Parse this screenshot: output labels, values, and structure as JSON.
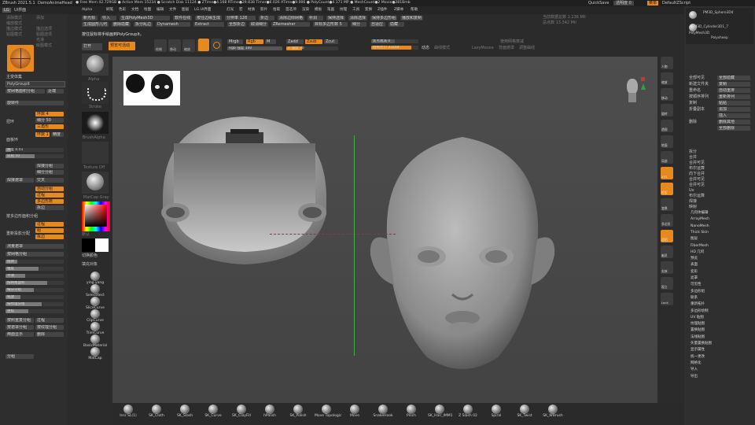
{
  "topbar": {
    "app_title": "ZBrush 2021.5.1",
    "doc_name": "DemoAnimeHead",
    "stats": "● Free Mem 42.729GB ● Active Mem 15234 ● Scratch Disk 11124 ● ZTime●4.168 RTime●29.838 Timer●6.026 ATime●9.006 ● PolyCount●4.171 MP ● MeshCount●2  Movie●281Bmb",
    "quicksave": "QuickSave",
    "see_through": "透明度 0",
    "menus_btn": "菜单",
    "script": "DefaultZScript"
  },
  "menubar": {
    "lightbox": "LG",
    "ui_label": "UI界面",
    "items": [
      "Alpha",
      "刷笔",
      "色彩",
      "文档",
      "绘图",
      "编辑",
      "文件",
      "图层",
      "LG.UI界面",
      "灯光",
      "宏",
      "材质",
      "影片",
      "拾取",
      "首选项",
      "渲染",
      "模板",
      "笔画",
      "纹理",
      "工具",
      "变换",
      "Z插件",
      "Z脚本",
      "帮助"
    ]
  },
  "left_panel": {
    "rows": [
      {
        "a": "清除模式",
        "b": "添加"
      },
      {
        "a": "缩放模式",
        "b": ""
      },
      {
        "a": "描边模式",
        "b": "描边选项"
      },
      {
        "a": "贴图模式",
        "b": "贴图选项"
      },
      {
        "a": "",
        "b": "光滑"
      },
      {
        "a": "",
        "b": "绘图模式"
      }
    ],
    "subtool_label": "主变体集",
    "polygroup_field": "PolyGroupIt",
    "polygroup_buttons": [
      "按网格面积分组",
      "近端"
    ],
    "rotate": "旋转件",
    "slices": [
      {
        "name": "扭环",
        "v1": "环数 4",
        "v2": "细分 50",
        "v3": "三角形",
        "v4": "环数 1",
        "v5": "精度"
      },
      {
        "name": "面板环"
      }
    ],
    "sliders": [
      {
        "label": "厚度 0.01",
        "fill": 0.1
      },
      {
        "label": "斜角 50",
        "fill": 0.5
      }
    ],
    "weld": [
      "焊接分组",
      "细分分组",
      "焊接遮罩",
      "交叉"
    ],
    "boolean": [
      "自动分组",
      "过程",
      "多边形数",
      "拆边"
    ],
    "more": [
      "按多边形面积分组",
      "过程",
      "组",
      "拆边",
      "重新投影分配",
      "按网格面积",
      "测量遮罩",
      "按网格分组"
    ],
    "bottom_sliders": [
      "扭转",
      "锥度",
      "平滑",
      "按网格面积",
      "细分分组",
      "缩放",
      "按纹理分组",
      "坐标"
    ],
    "footer": [
      "按照重复分组",
      "过程",
      "按遮罩分组",
      "按纹理分组",
      "两面显示",
      "删除",
      "分组"
    ]
  },
  "tool_shelf": {
    "items": [
      "Alpha",
      "Stroke",
      "BrushAlpha",
      "Texture Off",
      "MatCap Gray"
    ],
    "material_label": "默认",
    "color_label": "切换颜色",
    "gradient_label": "填充对象",
    "bottom": [
      "ying.yang",
      "SelectRect",
      "SliceCurve",
      "ClipCurve",
      "TrimCurve",
      "BasicMaterial",
      "MatCap"
    ]
  },
  "toolbar": {
    "row1": [
      {
        "label": "新光标",
        "style": "btn"
      },
      {
        "label": "导入",
        "style": "btn"
      },
      {
        "label": "生成PolyMesh3D",
        "style": "btn"
      },
      {
        "label": "软件在线",
        "style": "btn"
      },
      {
        "label": "按住边缘生成",
        "style": "btn"
      },
      {
        "label": "分辨率 128",
        "style": "btn"
      },
      {
        "label": "折边",
        "style": "btn"
      },
      {
        "label": "清除边际网格",
        "style": "btn"
      },
      {
        "label": "补洞",
        "style": "btn"
      },
      {
        "label": "保持选择",
        "style": "btn"
      },
      {
        "label": "清除选择",
        "style": "btn"
      },
      {
        "label": "保持多边形组",
        "style": "btn"
      },
      {
        "label": "播放和复制",
        "style": "btn"
      }
    ],
    "row2": [
      {
        "label": "生成圆形几何",
        "style": "btn"
      },
      {
        "label": "删除隐藏",
        "style": "btn"
      },
      {
        "label": "拆分乱边",
        "style": "btn"
      },
      {
        "label": "Dynamesh",
        "style": "btn"
      },
      {
        "label": "Extract",
        "style": "btn"
      },
      {
        "label": "全部折边",
        "style": "btn"
      },
      {
        "label": "取消细分",
        "style": "btn"
      },
      {
        "label": "ZRemesher",
        "style": "btn"
      },
      {
        "label": "目标多边形数 5",
        "style": "btn"
      },
      {
        "label": "细分",
        "style": "btn"
      },
      {
        "label": "自适应",
        "style": "btn"
      },
      {
        "label": "隐藏",
        "style": "btn"
      }
    ],
    "instruction": "按住鼠标将手绘画到PolyGroupIt。",
    "tools": [
      {
        "label": "打开",
        "style": "btn"
      },
      {
        "label": "预览可活动",
        "style": "obtn"
      },
      {
        "label": "绘制",
        "style": "btn"
      },
      {
        "label": "移动",
        "style": "btn"
      },
      {
        "label": "缩放",
        "style": "btn"
      },
      {
        "label": "旋转",
        "style": "btn"
      }
    ],
    "rgb_sliders": [
      {
        "label": "Mrgb",
        "style": "btn"
      },
      {
        "label": "Rgb",
        "style": "obtn"
      },
      {
        "label": "M",
        "style": "btn"
      },
      {
        "label": "Zadd",
        "style": "btn"
      },
      {
        "label": "Zsub",
        "style": "obtn"
      },
      {
        "label": "Zcut",
        "style": "btn"
      }
    ],
    "rgb_intensity": "Rgb 强度 100",
    "z_intensity": "Z 强度 30",
    "focal": "焦点衰减 0",
    "draw_size": "绘制大小 33164",
    "dynamic": "动态",
    "right_items": [
      "LazyMouse",
      "背面遮罩",
      "曲线模式",
      "使用网格衰减",
      "调整曲线"
    ],
    "info": [
      "当前数据总数 1.136 Mil",
      "总点数 13.342 Mil"
    ]
  },
  "right_panel": {
    "tool_names": [
      "PM3D_Sphere3D4",
      "PM3D_Cylinder3D1_7",
      "PolyMesh3D",
      "Polysheep"
    ],
    "buttons": [
      {
        "a": "全部可见",
        "b": "全部隐藏"
      },
      {
        "a": "新建文件夹",
        "b": "复制"
      },
      {
        "a": "重命名",
        "b": "自动重排"
      },
      {
        "a": "按顺序排列",
        "b": "重新排列"
      },
      {
        "a": "复制",
        "b": "粘贴"
      },
      {
        "a": "折叠副本",
        "b": "追加"
      },
      {
        "a": "",
        "b": "插入"
      },
      {
        "a": "删除",
        "b": "删除其他"
      },
      {
        "a": "",
        "b": "全部删除"
      }
    ],
    "split": [
      "拆分",
      "合并",
      "合并可见",
      "布尔运算"
    ],
    "extra": [
      "向下合并",
      "合并可见",
      "合并可见",
      "Uv",
      "布尔运算",
      "焊接",
      "映射",
      "投影",
      "提取"
    ],
    "menu_items": [
      "几何体编辑",
      "ArrayMesh",
      "NanoMesh",
      "Thick Skin",
      "图层",
      "FiberMesh",
      "HD 几何",
      "预览",
      "表面",
      "变形",
      "遮罩",
      "可见性",
      "多边形组",
      "联系",
      "重新拓扑",
      "多边形绘制",
      "UV 贴图",
      "纹理贴图",
      "置换贴图",
      "法线贴图",
      "矢量置换贴图",
      "显示属性",
      "统一更改",
      "网格化",
      "导入",
      "导出"
    ]
  },
  "side_icons": [
    "人物",
    "缩放",
    "移动",
    "旋转",
    "透视",
    "地面",
    "局部",
    "XYZ",
    "框架",
    "变换",
    "多边形",
    "透明",
    "幽灵",
    "实体",
    "孤立",
    "Lock"
  ],
  "bottom_brushes": [
    "Insr SL(1)",
    "SK_Cloth",
    "SK_Slash",
    "SK_Curve",
    "SK_ClayFill",
    "hPolish",
    "SK_Polish",
    "Move Topologic",
    "Move",
    "SnakeHook",
    "Pinch",
    "SK_Hair_IMM1",
    "Z Slash 02",
    "Spiral",
    "SK_Twist",
    "SK_WBrush"
  ],
  "colors": {
    "accent": "#e8891e",
    "canvas": "#4a4a4a",
    "panel": "#2b2b2b",
    "button": "#454545"
  }
}
